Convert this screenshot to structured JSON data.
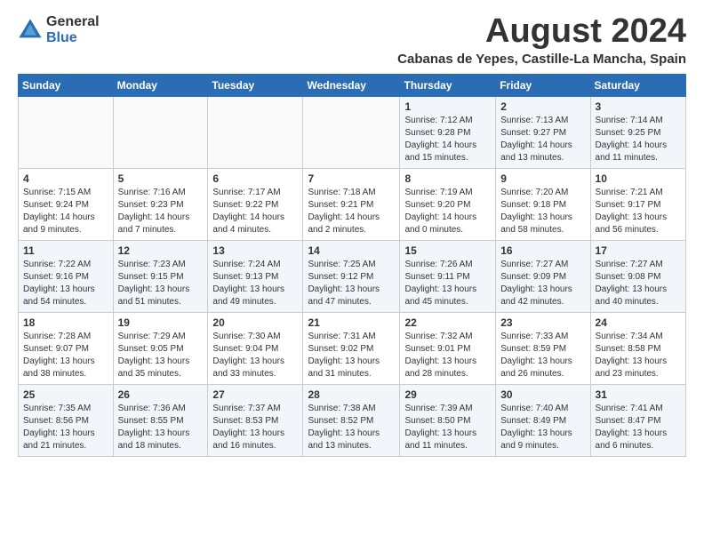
{
  "logo": {
    "general": "General",
    "blue": "Blue"
  },
  "header": {
    "month": "August 2024",
    "location": "Cabanas de Yepes, Castille-La Mancha, Spain"
  },
  "days_of_week": [
    "Sunday",
    "Monday",
    "Tuesday",
    "Wednesday",
    "Thursday",
    "Friday",
    "Saturday"
  ],
  "weeks": [
    [
      {
        "num": "",
        "info": ""
      },
      {
        "num": "",
        "info": ""
      },
      {
        "num": "",
        "info": ""
      },
      {
        "num": "",
        "info": ""
      },
      {
        "num": "1",
        "info": "Sunrise: 7:12 AM\nSunset: 9:28 PM\nDaylight: 14 hours\nand 15 minutes."
      },
      {
        "num": "2",
        "info": "Sunrise: 7:13 AM\nSunset: 9:27 PM\nDaylight: 14 hours\nand 13 minutes."
      },
      {
        "num": "3",
        "info": "Sunrise: 7:14 AM\nSunset: 9:25 PM\nDaylight: 14 hours\nand 11 minutes."
      }
    ],
    [
      {
        "num": "4",
        "info": "Sunrise: 7:15 AM\nSunset: 9:24 PM\nDaylight: 14 hours\nand 9 minutes."
      },
      {
        "num": "5",
        "info": "Sunrise: 7:16 AM\nSunset: 9:23 PM\nDaylight: 14 hours\nand 7 minutes."
      },
      {
        "num": "6",
        "info": "Sunrise: 7:17 AM\nSunset: 9:22 PM\nDaylight: 14 hours\nand 4 minutes."
      },
      {
        "num": "7",
        "info": "Sunrise: 7:18 AM\nSunset: 9:21 PM\nDaylight: 14 hours\nand 2 minutes."
      },
      {
        "num": "8",
        "info": "Sunrise: 7:19 AM\nSunset: 9:20 PM\nDaylight: 14 hours\nand 0 minutes."
      },
      {
        "num": "9",
        "info": "Sunrise: 7:20 AM\nSunset: 9:18 PM\nDaylight: 13 hours\nand 58 minutes."
      },
      {
        "num": "10",
        "info": "Sunrise: 7:21 AM\nSunset: 9:17 PM\nDaylight: 13 hours\nand 56 minutes."
      }
    ],
    [
      {
        "num": "11",
        "info": "Sunrise: 7:22 AM\nSunset: 9:16 PM\nDaylight: 13 hours\nand 54 minutes."
      },
      {
        "num": "12",
        "info": "Sunrise: 7:23 AM\nSunset: 9:15 PM\nDaylight: 13 hours\nand 51 minutes."
      },
      {
        "num": "13",
        "info": "Sunrise: 7:24 AM\nSunset: 9:13 PM\nDaylight: 13 hours\nand 49 minutes."
      },
      {
        "num": "14",
        "info": "Sunrise: 7:25 AM\nSunset: 9:12 PM\nDaylight: 13 hours\nand 47 minutes."
      },
      {
        "num": "15",
        "info": "Sunrise: 7:26 AM\nSunset: 9:11 PM\nDaylight: 13 hours\nand 45 minutes."
      },
      {
        "num": "16",
        "info": "Sunrise: 7:27 AM\nSunset: 9:09 PM\nDaylight: 13 hours\nand 42 minutes."
      },
      {
        "num": "17",
        "info": "Sunrise: 7:27 AM\nSunset: 9:08 PM\nDaylight: 13 hours\nand 40 minutes."
      }
    ],
    [
      {
        "num": "18",
        "info": "Sunrise: 7:28 AM\nSunset: 9:07 PM\nDaylight: 13 hours\nand 38 minutes."
      },
      {
        "num": "19",
        "info": "Sunrise: 7:29 AM\nSunset: 9:05 PM\nDaylight: 13 hours\nand 35 minutes."
      },
      {
        "num": "20",
        "info": "Sunrise: 7:30 AM\nSunset: 9:04 PM\nDaylight: 13 hours\nand 33 minutes."
      },
      {
        "num": "21",
        "info": "Sunrise: 7:31 AM\nSunset: 9:02 PM\nDaylight: 13 hours\nand 31 minutes."
      },
      {
        "num": "22",
        "info": "Sunrise: 7:32 AM\nSunset: 9:01 PM\nDaylight: 13 hours\nand 28 minutes."
      },
      {
        "num": "23",
        "info": "Sunrise: 7:33 AM\nSunset: 8:59 PM\nDaylight: 13 hours\nand 26 minutes."
      },
      {
        "num": "24",
        "info": "Sunrise: 7:34 AM\nSunset: 8:58 PM\nDaylight: 13 hours\nand 23 minutes."
      }
    ],
    [
      {
        "num": "25",
        "info": "Sunrise: 7:35 AM\nSunset: 8:56 PM\nDaylight: 13 hours\nand 21 minutes."
      },
      {
        "num": "26",
        "info": "Sunrise: 7:36 AM\nSunset: 8:55 PM\nDaylight: 13 hours\nand 18 minutes."
      },
      {
        "num": "27",
        "info": "Sunrise: 7:37 AM\nSunset: 8:53 PM\nDaylight: 13 hours\nand 16 minutes."
      },
      {
        "num": "28",
        "info": "Sunrise: 7:38 AM\nSunset: 8:52 PM\nDaylight: 13 hours\nand 13 minutes."
      },
      {
        "num": "29",
        "info": "Sunrise: 7:39 AM\nSunset: 8:50 PM\nDaylight: 13 hours\nand 11 minutes."
      },
      {
        "num": "30",
        "info": "Sunrise: 7:40 AM\nSunset: 8:49 PM\nDaylight: 13 hours\nand 9 minutes."
      },
      {
        "num": "31",
        "info": "Sunrise: 7:41 AM\nSunset: 8:47 PM\nDaylight: 13 hours\nand 6 minutes."
      }
    ]
  ]
}
